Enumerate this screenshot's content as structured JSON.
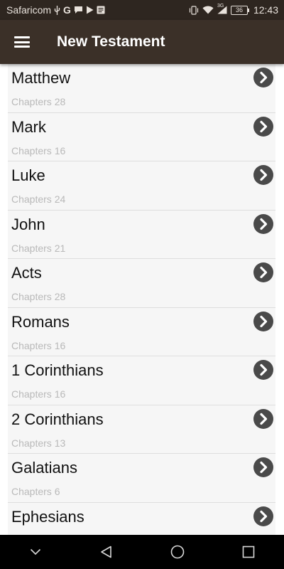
{
  "status_bar": {
    "carrier": "Safaricom",
    "network_label": "3G",
    "battery_level": "36",
    "time": "12:43"
  },
  "app_bar": {
    "title": "New Testament",
    "menu_icon": "hamburger-menu-icon"
  },
  "books": [
    {
      "name": "Matthew",
      "chapters": "Chapters 28"
    },
    {
      "name": "Mark",
      "chapters": "Chapters 16"
    },
    {
      "name": "Luke",
      "chapters": "Chapters 24"
    },
    {
      "name": "John",
      "chapters": "Chapters 21"
    },
    {
      "name": "Acts",
      "chapters": "Chapters 28"
    },
    {
      "name": "Romans",
      "chapters": "Chapters 16"
    },
    {
      "name": "1 Corinthians",
      "chapters": "Chapters 16"
    },
    {
      "name": "2 Corinthians",
      "chapters": "Chapters 13"
    },
    {
      "name": "Galatians",
      "chapters": "Chapters 6"
    },
    {
      "name": "Ephesians",
      "chapters": ""
    }
  ],
  "colors": {
    "app_bar": "#3b3028",
    "status_bar": "#2e2620",
    "arrow_circle": "#4a4a4a"
  }
}
